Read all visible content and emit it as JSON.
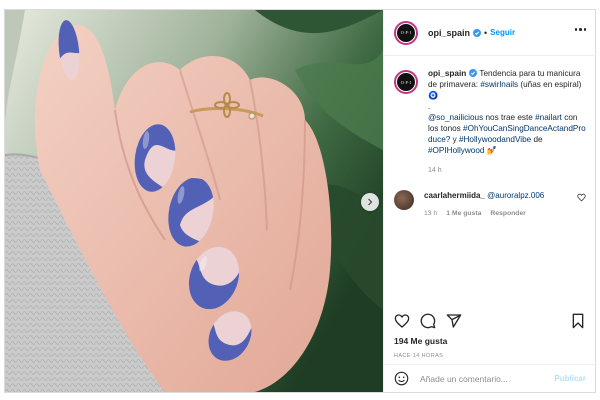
{
  "post": {
    "account": "opi_spain",
    "follow_label": "Seguir",
    "separator": "•",
    "avatar_text": "O·P·I",
    "caption": {
      "username": "opi_spain",
      "line1": " Tendencia para tu manicura de primavera: ",
      "tag1": "#swirlnails",
      "line2": " (uñas en espiral) ",
      "emoji1": "🧿",
      "dot": ".",
      "mention1": "@so_nailicious",
      "line3": " nos trae este ",
      "tag2": "#nailart",
      "line4": " con los tonos ",
      "tag3": "#OhYouCanSingDanceActandProduce?",
      "line5": " y ",
      "tag4": "#HollywoodandVibe",
      "line6": " de ",
      "tag5": "#OPIHollywood",
      "emoji2": " 💅",
      "time": "14 h"
    },
    "comment": {
      "username": "caarlahermiida_",
      "mention": "@auroralpz.006",
      "time": "13 h",
      "likes": "1 Me gusta",
      "reply": "Responder"
    },
    "likes": "194 Me gusta",
    "ago": "HACE 14 HORAS",
    "comment_input": {
      "placeholder": "Añade un comentario..."
    },
    "publish_label": "Publicar"
  },
  "icons": [
    "heart-icon",
    "comment-icon",
    "share-icon",
    "bookmark-icon",
    "emoji-icon",
    "more-icon",
    "verified-icon",
    "chevron-right-icon"
  ],
  "colors": {
    "accent": "#0095f6",
    "hashtag": "#00376b",
    "nail_blue": "#5261b5",
    "nail_pink": "#ecd2d4",
    "sweater": "#c9c9c9"
  }
}
